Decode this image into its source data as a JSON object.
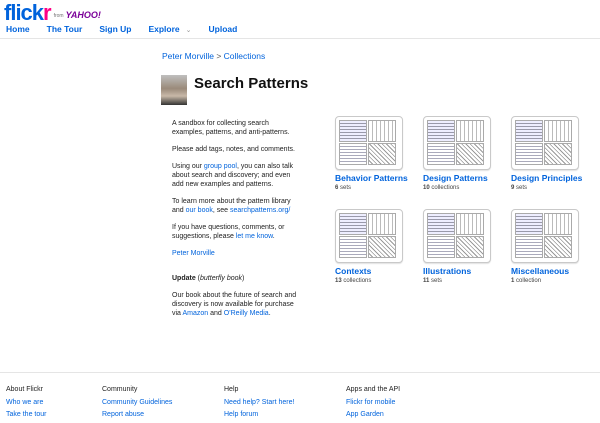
{
  "header": {
    "logo_flick": "flick",
    "logo_r": "r",
    "logo_from": "from",
    "logo_yahoo": "YAHOO!",
    "nav": [
      "Home",
      "The Tour",
      "Sign Up",
      "Explore",
      "Upload"
    ],
    "explore_caret": "⌄"
  },
  "breadcrumb": {
    "user": "Peter Morville",
    "separator": " > ",
    "section": "Collections"
  },
  "title": "Search Patterns",
  "description": {
    "p1": "A sandbox for collecting search examples, patterns, and anti-patterns.",
    "p2": "Please add tags, notes, and comments.",
    "p3_pre": "Using our ",
    "p3_link": "group pool",
    "p3_post": ", you can also talk about search and discovery; and even add new examples and patterns.",
    "p4_pre": "To learn more about the pattern library and ",
    "p4_link1": "our book",
    "p4_mid": ", see ",
    "p4_link2": "searchpatterns.org/",
    "p5_pre": "If you have questions, comments, or suggestions, please ",
    "p5_link": "let me know",
    "p5_post": ".",
    "author_link": "Peter Morville",
    "update_label": "Update",
    "update_paren_open": " (",
    "update_italic": "butterfly book",
    "update_paren_close": ")",
    "p7_pre": "Our book about the future of search and discovery is now available for purchase via ",
    "p7_link1": "Amazon",
    "p7_mid": " and ",
    "p7_link2": "O'Reilly Media",
    "p7_post": "."
  },
  "collections": [
    {
      "name": "Behavior Patterns",
      "count": "6",
      "unit": " sets"
    },
    {
      "name": "Design Patterns",
      "count": "10",
      "unit": " collections"
    },
    {
      "name": "Design Principles",
      "count": "9",
      "unit": " sets"
    },
    {
      "name": "Contexts",
      "count": "13",
      "unit": " collections"
    },
    {
      "name": "Illustrations",
      "count": "11",
      "unit": " sets"
    },
    {
      "name": "Miscellaneous",
      "count": "1",
      "unit": " collection"
    }
  ],
  "footer": [
    {
      "heading": "About Flickr",
      "links": [
        "Who we are",
        "Take the tour"
      ]
    },
    {
      "heading": "Community",
      "links": [
        "Community Guidelines",
        "Report abuse"
      ]
    },
    {
      "heading": "Help",
      "links": [
        "Need help? Start here!",
        "Help forum"
      ]
    },
    {
      "heading": "Apps and the API",
      "links": [
        "Flickr for mobile",
        "App Garden"
      ]
    }
  ]
}
